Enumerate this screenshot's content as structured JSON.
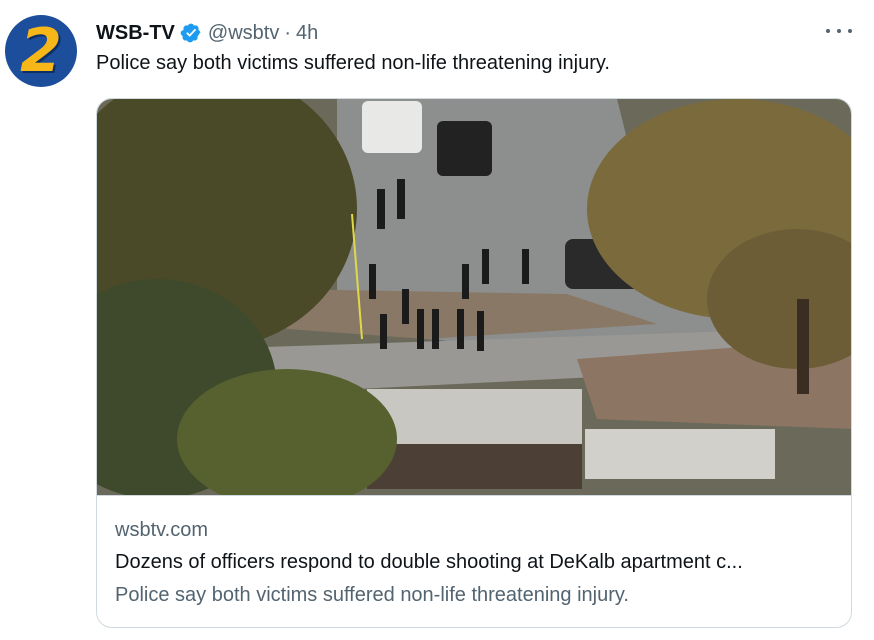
{
  "tweet": {
    "avatar_text": "2",
    "display_name": "WSB-TV",
    "handle": "@wsbtv",
    "separator": "·",
    "time": "4h",
    "text": "Police say both victims suffered non-life threatening injury.",
    "more_icon": "more-horizontal-icon",
    "verified_icon": "verified-badge-icon"
  },
  "card": {
    "domain": "wsbtv.com",
    "title": "Dozens of officers respond to double shooting at DeKalb apartment c...",
    "description": "Police say both victims suffered non-life threatening injury."
  },
  "colors": {
    "verified": "#1d9bf0",
    "secondary_text": "#536471",
    "border": "#cfd9de",
    "avatar_bg": "#1d4e9c",
    "avatar_fg": "#f7b718"
  }
}
